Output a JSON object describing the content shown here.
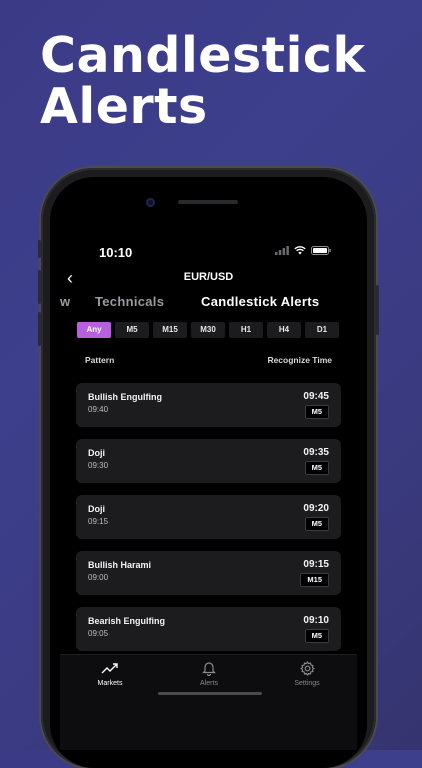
{
  "headline": {
    "line1": "Candlestick",
    "line2": "Alerts"
  },
  "status_bar": {
    "time": "10:10"
  },
  "nav": {
    "back": "‹",
    "title": "EUR/USD"
  },
  "tabs": {
    "partial": "w",
    "technicals": "Technicals",
    "candlestick": "Candlestick Alerts"
  },
  "timeframes": [
    "Any",
    "M5",
    "M15",
    "M30",
    "H1",
    "H4",
    "D1"
  ],
  "selected_timeframe": "Any",
  "columns": {
    "pattern": "Pattern",
    "time": "Recognize Time"
  },
  "alerts": [
    {
      "name": "Bullish Engulfing",
      "sub": "09:40",
      "time": "09:45",
      "tf": "M5"
    },
    {
      "name": "Doji",
      "sub": "09:30",
      "time": "09:35",
      "tf": "M5"
    },
    {
      "name": "Doji",
      "sub": "09:15",
      "time": "09:20",
      "tf": "M5"
    },
    {
      "name": "Bullish Harami",
      "sub": "09:00",
      "time": "09:15",
      "tf": "M15"
    },
    {
      "name": "Bearish Engulfing",
      "sub": "09:05",
      "time": "09:10",
      "tf": "M5"
    }
  ],
  "bottom_nav": [
    {
      "label": "Markets",
      "icon": "trending-up-icon",
      "active": true
    },
    {
      "label": "Alerts",
      "icon": "bell-icon",
      "active": false
    },
    {
      "label": "Settings",
      "icon": "gear-icon",
      "active": false
    }
  ],
  "colors": {
    "accent": "#b760e0",
    "card": "#1c1c1e",
    "background": "#3b3a86"
  }
}
